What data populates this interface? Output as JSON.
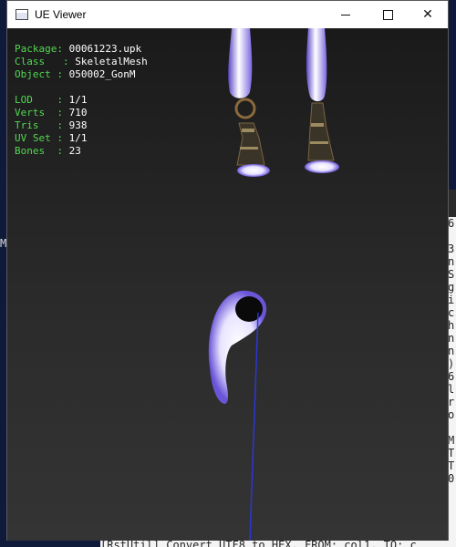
{
  "window": {
    "title": "UE Viewer",
    "buttons": {
      "minimize": "minimize",
      "maximize": "maximize",
      "close": "✕"
    }
  },
  "info": {
    "package": {
      "label": "Package",
      "value": "00061223.upk"
    },
    "class": {
      "label": "Class",
      "value": "SkeletalMesh"
    },
    "object": {
      "label": "Object",
      "value": "050002_GonM"
    },
    "lod": {
      "label": "LOD",
      "value": "1/1"
    },
    "verts": {
      "label": "Verts",
      "value": "710"
    },
    "tris": {
      "label": "Tris",
      "value": "938"
    },
    "uvset": {
      "label": "UV Set",
      "value": "1/1"
    },
    "bones": {
      "label": "Bones",
      "value": "23"
    }
  },
  "background": {
    "left_letter": "M",
    "console_chars": [
      "6",
      "",
      "3",
      "n",
      "S",
      "g",
      "i",
      "c",
      "h",
      "n",
      "n",
      ")",
      "6",
      "l",
      "r",
      "o",
      "",
      "M",
      "T",
      "T",
      "0"
    ],
    "bottom_console": "[RstUtil] Convert UTF8 to HEX, FROM: col1, TO: c"
  }
}
